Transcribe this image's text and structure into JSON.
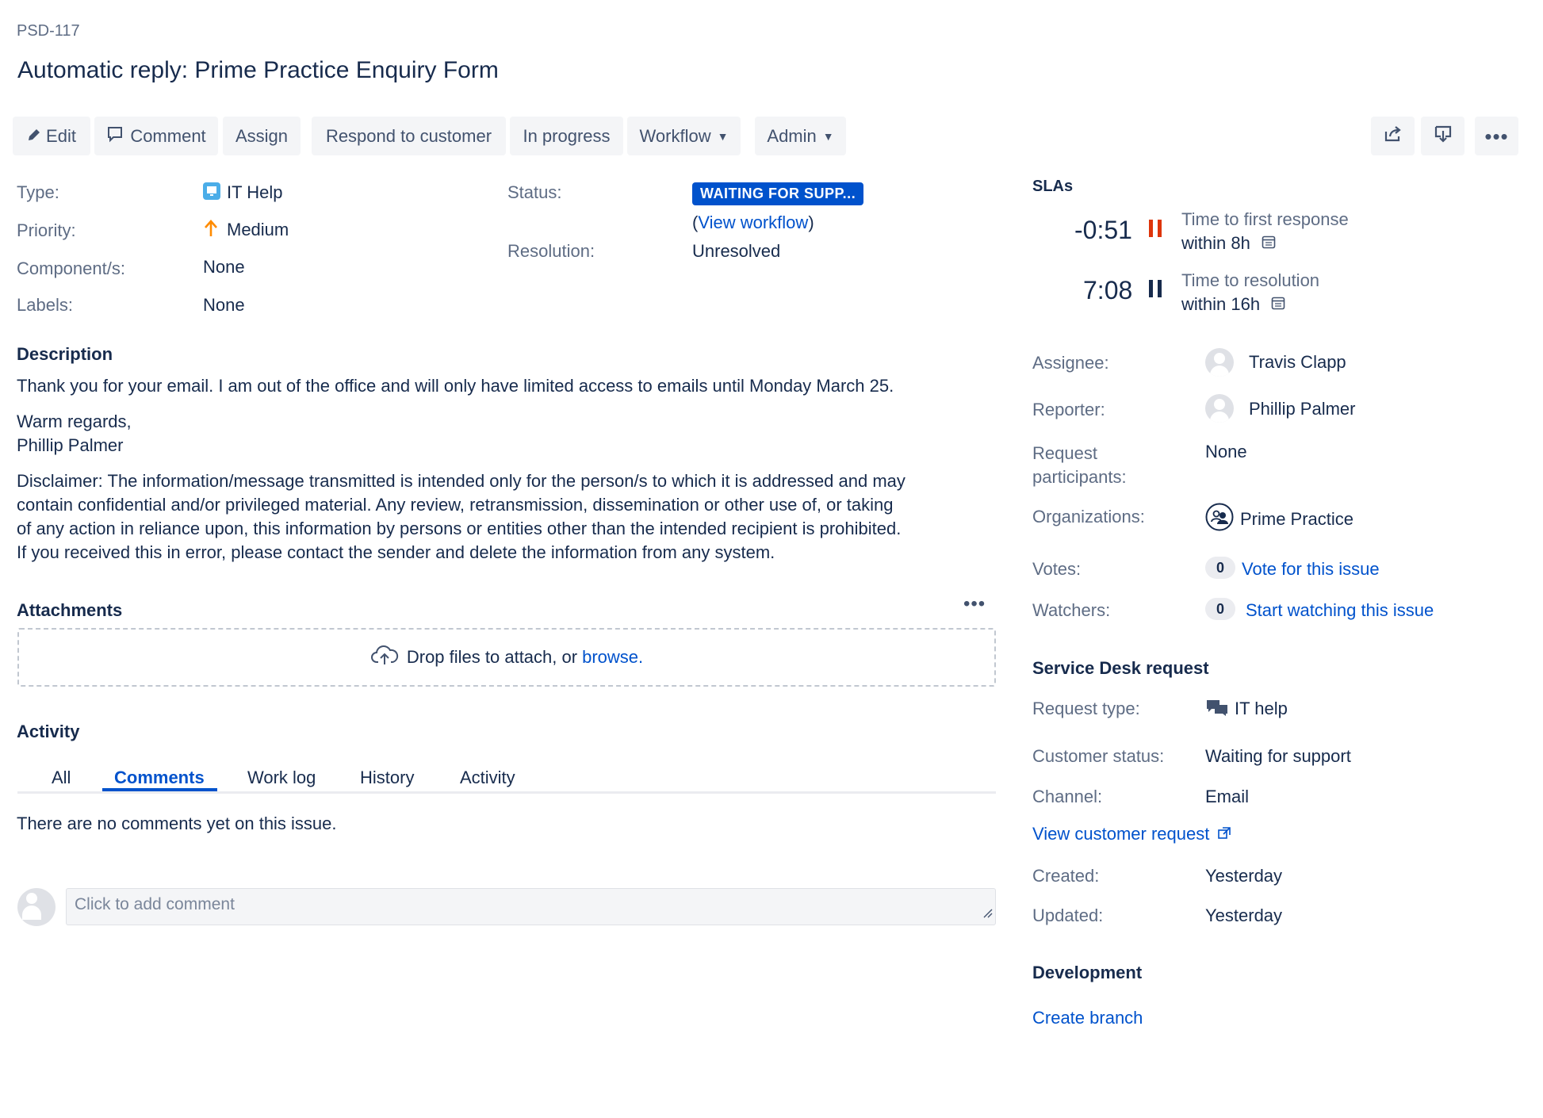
{
  "issue": {
    "key": "PSD-117",
    "title": "Automatic reply: Prime Practice Enquiry Form"
  },
  "toolbar": {
    "edit": "Edit",
    "comment": "Comment",
    "assign": "Assign",
    "respond": "Respond to customer",
    "in_progress": "In progress",
    "workflow": "Workflow",
    "admin": "Admin"
  },
  "details": {
    "type_label": "Type:",
    "type_value": "IT Help",
    "priority_label": "Priority:",
    "priority_value": "Medium",
    "component_label": "Component/s:",
    "component_value": "None",
    "labels_label": "Labels:",
    "labels_value": "None",
    "status_label": "Status:",
    "status_value": "WAITING FOR SUPP...",
    "view_workflow_open": "(",
    "view_workflow": "View workflow",
    "view_workflow_close": ")",
    "resolution_label": "Resolution:",
    "resolution_value": "Unresolved"
  },
  "description": {
    "title": "Description",
    "p1": "Thank you for your email. I am out of the office and will only have limited access to emails until Monday March 25.",
    "p2_line1": "Warm regards,",
    "p2_line2": "Phillip Palmer",
    "p3_line1": "Disclaimer: The information/message transmitted is intended only for the person/s to which it is addressed and may",
    "p3_line2": "contain confidential and/or privileged material. Any review, retransmission, dissemination or other use of, or taking",
    "p3_line3": "of any action in reliance upon, this information by persons or entities other than the intended recipient is prohibited.",
    "p3_line4": "If you received this in error, please contact the sender and delete the information from any system."
  },
  "attachments": {
    "title": "Attachments",
    "drop_text": "Drop files to attach, or",
    "browse": "browse."
  },
  "activity": {
    "title": "Activity",
    "tabs": [
      "All",
      "Comments",
      "Work log",
      "History",
      "Activity"
    ],
    "active_tab": "Comments",
    "empty": "There are no comments yet on this issue.",
    "comment_placeholder": "Click to add comment"
  },
  "slas": {
    "title": "SLAs",
    "items": [
      {
        "time": "-0:51",
        "label": "Time to first response",
        "goal": "within 8h",
        "state": "breached"
      },
      {
        "time": "7:08",
        "label": "Time to resolution",
        "goal": "within 16h",
        "state": "paused"
      }
    ]
  },
  "people": {
    "assignee_label": "Assignee:",
    "assignee": "Travis Clapp",
    "reporter_label": "Reporter:",
    "reporter": "Phillip Palmer",
    "participants_label_1": "Request",
    "participants_label_2": "participants:",
    "participants": "None",
    "organizations_label": "Organizations:",
    "organization": "Prime Practice",
    "votes_label": "Votes:",
    "votes_count": "0",
    "vote_link": "Vote for this issue",
    "watchers_label": "Watchers:",
    "watchers_count": "0",
    "watch_link": "Start watching this issue"
  },
  "service_desk": {
    "title": "Service Desk request",
    "request_type_label": "Request type:",
    "request_type": "IT help",
    "customer_status_label": "Customer status:",
    "customer_status": "Waiting for support",
    "channel_label": "Channel:",
    "channel": "Email",
    "view_request": "View customer request",
    "created_label": "Created:",
    "created": "Yesterday",
    "updated_label": "Updated:",
    "updated": "Yesterday"
  },
  "development": {
    "title": "Development",
    "create_branch": "Create branch"
  },
  "colors": {
    "status_badge": "#0052cc",
    "link": "#0052cc",
    "sla_breached": "#de350b",
    "priority_medium": "#ff8b00",
    "text": "#172b4d",
    "muted": "#5e6c84"
  }
}
